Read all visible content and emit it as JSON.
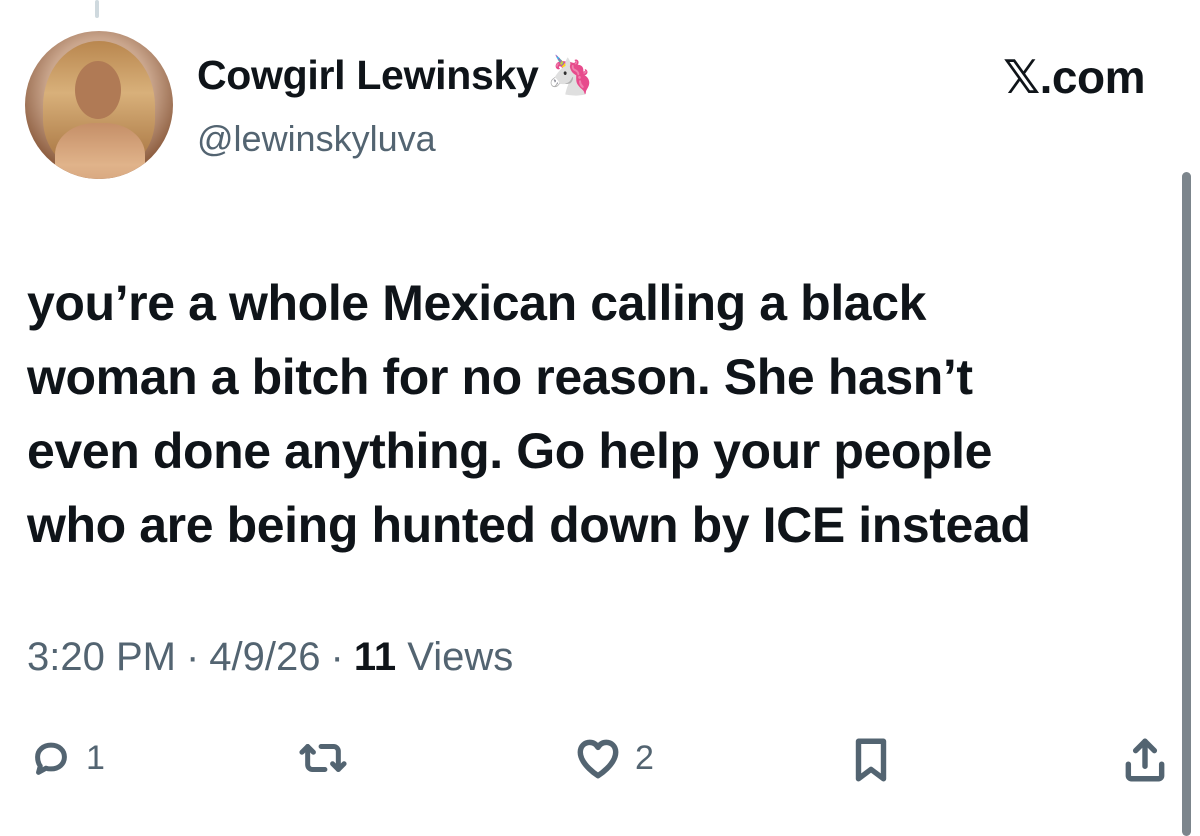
{
  "author": {
    "display_name": "Cowgirl Lewinsky",
    "badge_emoji": "🦄",
    "handle": "@lewinskyluva"
  },
  "site": {
    "label": ".com",
    "logo": "𝕏"
  },
  "tweet": {
    "lines": [
      "you’re a whole Mexican calling a black",
      "woman a bitch for no reason. She hasn’t",
      "even done anything. Go help your people",
      "who are being hunted down by ICE instead"
    ]
  },
  "meta": {
    "time": "3:20 PM",
    "separator": "·",
    "date": "4/9/26",
    "views_count": "11",
    "views_label": "Views"
  },
  "actions": {
    "reply_count": "1",
    "like_count": "2",
    "icons": [
      "reply-icon",
      "repost-icon",
      "like-icon",
      "bookmark-icon",
      "share-icon"
    ]
  }
}
